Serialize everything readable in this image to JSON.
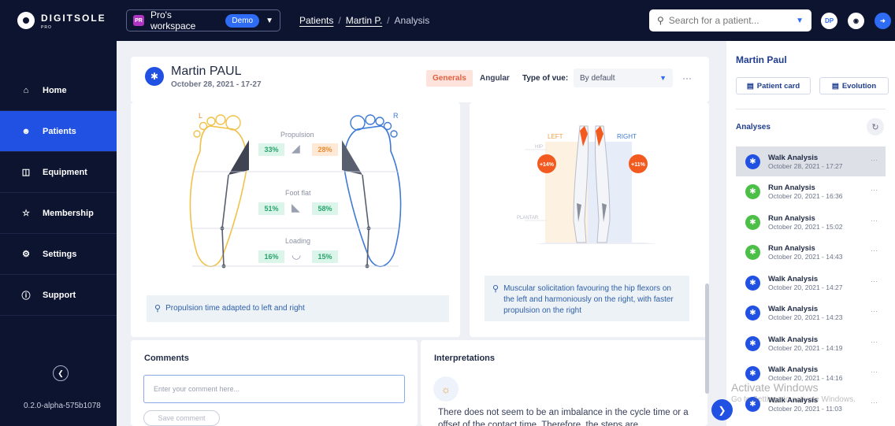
{
  "brand": {
    "name": "DIGITSOLE",
    "sub": "PRO"
  },
  "workspace": {
    "initials": "PR",
    "name": "Pro's workspace",
    "badge": "Demo"
  },
  "breadcrumb": [
    "Patients",
    "Martin P.",
    "Analysis"
  ],
  "search": {
    "placeholder": "Search for a patient..."
  },
  "user": {
    "initials": "DP"
  },
  "sidebar": {
    "items": [
      {
        "label": "Home",
        "icon": "home-icon"
      },
      {
        "label": "Patients",
        "icon": "patients-icon",
        "active": true
      },
      {
        "label": "Equipment",
        "icon": "equipment-icon"
      },
      {
        "label": "Membership",
        "icon": "membership-icon"
      },
      {
        "label": "Settings",
        "icon": "settings-icon"
      },
      {
        "label": "Support",
        "icon": "support-icon"
      }
    ],
    "version": "0.2.0-alpha-575b1078"
  },
  "header": {
    "patient_name": "Martin PAUL",
    "date": "October 28, 2021 - 17-27",
    "tabs": [
      "Generals",
      "Angular"
    ],
    "vue_label": "Type of vue:",
    "vue_value": "By default"
  },
  "feet": {
    "left_label": "L",
    "right_label": "R",
    "phases": [
      {
        "name": "Propulsion",
        "left": "33%",
        "right": "28%"
      },
      {
        "name": "Foot flat",
        "left": "51%",
        "right": "58%"
      },
      {
        "name": "Loading",
        "left": "16%",
        "right": "15%"
      }
    ],
    "info": "Propulsion time adapted to left and right"
  },
  "muscle": {
    "left_label": "LEFT",
    "right_label": "RIGHT",
    "hip_label": "HIP",
    "plantar_label": "PLANTAR",
    "left_value": "+14%",
    "right_value": "+11%",
    "info": "Muscular solicitation favouring the hip flexors on the left and harmoniously on the right, with faster propulsion on the right"
  },
  "comments": {
    "title": "Comments",
    "placeholder": "Enter your comment here...",
    "save": "Save comment"
  },
  "interpretations": {
    "title": "Interpretations",
    "text": "There does not seem to be an imbalance in the cycle time or a offset of the contact time. Therefore, the steps are"
  },
  "right_panel": {
    "name": "Martin Paul",
    "patient_card": "Patient card",
    "evolution": "Evolution",
    "analyses_title": "Analyses",
    "analyses": [
      {
        "type": "walk",
        "title": "Walk Analysis",
        "date": "October 28, 2021 - 17:27",
        "selected": true
      },
      {
        "type": "run",
        "title": "Run Analysis",
        "date": "October 20, 2021 - 16:36"
      },
      {
        "type": "run",
        "title": "Run Analysis",
        "date": "October 20, 2021 - 15:02"
      },
      {
        "type": "run",
        "title": "Run Analysis",
        "date": "October 20, 2021 - 14:43"
      },
      {
        "type": "walk",
        "title": "Walk Analysis",
        "date": "October 20, 2021 - 14:27"
      },
      {
        "type": "walk",
        "title": "Walk Analysis",
        "date": "October 20, 2021 - 14:23"
      },
      {
        "type": "walk",
        "title": "Walk Analysis",
        "date": "October 20, 2021 - 14:19"
      },
      {
        "type": "walk",
        "title": "Walk Analysis",
        "date": "October 20, 2021 - 14:16"
      },
      {
        "type": "walk",
        "title": "Walk Analysis",
        "date": "October 20, 2021 - 11:03"
      }
    ]
  },
  "watermark": {
    "title": "Activate Windows",
    "sub": "Go to Settings to activate Windows."
  },
  "colors": {
    "navy": "#0d1430",
    "blue": "#2151e3",
    "green": "#4cbf46",
    "orange": "#ec8a2c",
    "left_foot": "#f0c24a",
    "right_foot": "#3f7ad6"
  }
}
